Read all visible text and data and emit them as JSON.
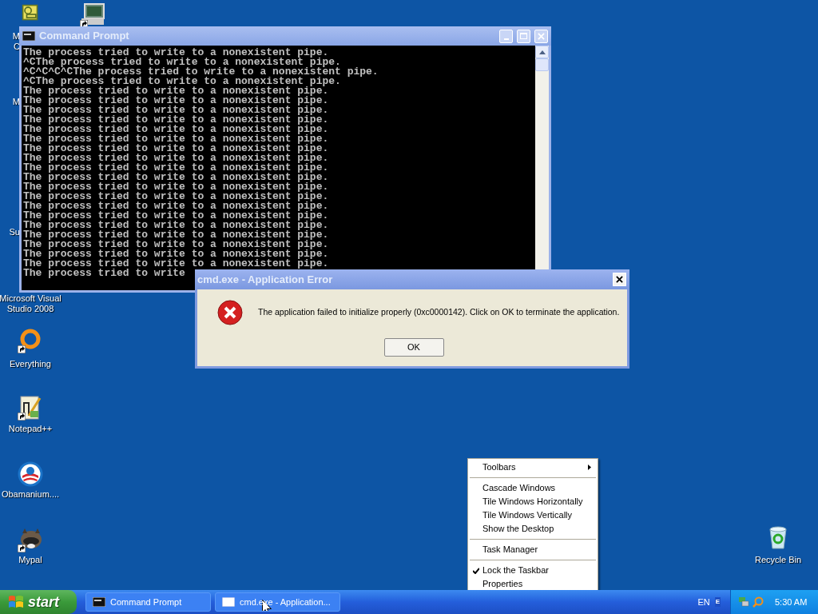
{
  "desktop_icons": [
    {
      "kind": "clock",
      "shortcut": false,
      "label_lines": [
        "M",
        "C"
      ]
    },
    {
      "kind": "monitor",
      "shortcut": true
    },
    {
      "label_lines": [
        "M"
      ]
    },
    {
      "label_lines": [
        "Su"
      ]
    },
    {
      "label_lines": [
        "Microsoft Visual",
        "Studio 2008"
      ]
    },
    {
      "kind": "ring",
      "shortcut": true,
      "label_lines": [
        "Everything"
      ]
    },
    {
      "kind": "notepad",
      "shortcut": true,
      "label_lines": [
        "Notepad++"
      ]
    },
    {
      "kind": "circle-logo",
      "shortcut": false,
      "label_lines": [
        "Obamanium...."
      ]
    },
    {
      "kind": "animal",
      "shortcut": true,
      "label_lines": [
        "Mypal"
      ]
    },
    {
      "kind": "recycle-bin",
      "shortcut": false,
      "label_lines": [
        "Recycle Bin"
      ]
    }
  ],
  "console_window": {
    "title": "Command Prompt",
    "lines": [
      "The process tried to write to a nonexistent pipe.",
      "^CThe process tried to write to a nonexistent pipe.",
      "^C^C^C^CThe process tried to write to a nonexistent pipe.",
      "^CThe process tried to write to a nonexistent pipe.",
      "The process tried to write to a nonexistent pipe.",
      "The process tried to write to a nonexistent pipe.",
      "The process tried to write to a nonexistent pipe.",
      "The process tried to write to a nonexistent pipe.",
      "The process tried to write to a nonexistent pipe.",
      "The process tried to write to a nonexistent pipe.",
      "The process tried to write to a nonexistent pipe.",
      "The process tried to write to a nonexistent pipe.",
      "The process tried to write to a nonexistent pipe.",
      "The process tried to write to a nonexistent pipe.",
      "The process tried to write to a nonexistent pipe.",
      "The process tried to write to a nonexistent pipe.",
      "The process tried to write to a nonexistent pipe.",
      "The process tried to write to a nonexistent pipe.",
      "The process tried to write to a nonexistent pipe.",
      "The process tried to write to a nonexistent pipe.",
      "The process tried to write to a nonexistent pipe.",
      "The process tried to write to a nonexistent pipe.",
      "The process tried to write to a nonexistent pipe.",
      "The process tried to write"
    ]
  },
  "error_dialog": {
    "title": "cmd.exe - Application Error",
    "message": "The application failed to initialize properly (0xc0000142). Click on OK to terminate the application.",
    "button": "OK"
  },
  "context_menu": {
    "items": [
      {
        "kind": "item",
        "label": "Toolbars",
        "submenu": true,
        "checked": false
      },
      {
        "kind": "separator"
      },
      {
        "kind": "item",
        "label": "Cascade Windows",
        "submenu": false,
        "checked": false
      },
      {
        "kind": "item",
        "label": "Tile Windows Horizontally",
        "submenu": false,
        "checked": false
      },
      {
        "kind": "item",
        "label": "Tile Windows Vertically",
        "submenu": false,
        "checked": false
      },
      {
        "kind": "item",
        "label": "Show the Desktop",
        "submenu": false,
        "checked": false
      },
      {
        "kind": "separator"
      },
      {
        "kind": "item",
        "label": "Task Manager",
        "submenu": false,
        "checked": false
      },
      {
        "kind": "separator"
      },
      {
        "kind": "item",
        "label": "Lock the Taskbar",
        "submenu": false,
        "checked": true
      },
      {
        "kind": "item",
        "label": "Properties",
        "submenu": false,
        "checked": false
      }
    ]
  },
  "taskbar": {
    "start": "start",
    "buttons": [
      {
        "kind": "console",
        "label": "Command Prompt",
        "selected": false
      },
      {
        "kind": "blank",
        "label": "cmd.exe - Application...",
        "selected": false
      }
    ],
    "language": "EN",
    "language_bar_label": "E",
    "clock": "5:30 AM"
  }
}
